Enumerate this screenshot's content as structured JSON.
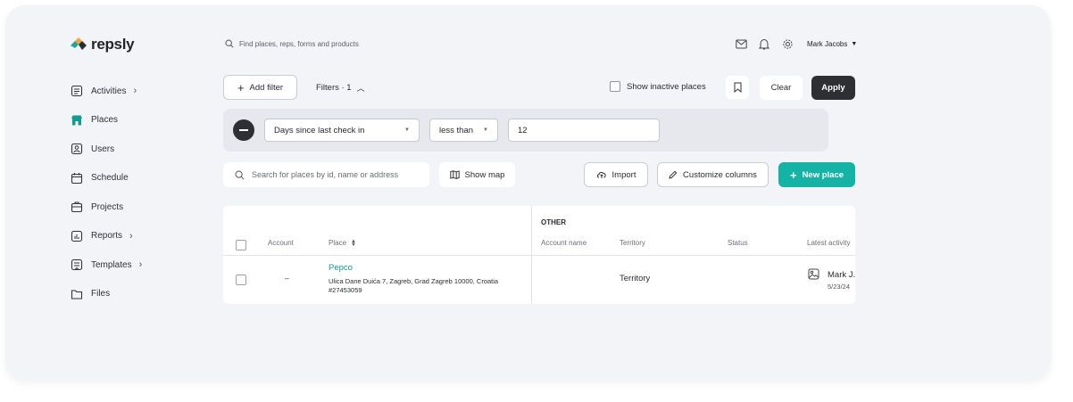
{
  "brand": {
    "name": "repsly"
  },
  "topbar": {
    "search_placeholder": "Find places, reps, forms and products",
    "icons": [
      "mail-icon",
      "bell-icon",
      "gear-icon"
    ],
    "user_name": "Mark Jacobs"
  },
  "sidebar": {
    "items": [
      {
        "label": "Activities",
        "icon": "activities-icon",
        "has_chevron": true
      },
      {
        "label": "Places",
        "icon": "store-icon",
        "has_chevron": false,
        "active": true
      },
      {
        "label": "Users",
        "icon": "user-icon",
        "has_chevron": false
      },
      {
        "label": "Schedule",
        "icon": "calendar-icon",
        "has_chevron": false
      },
      {
        "label": "Projects",
        "icon": "briefcase-icon",
        "has_chevron": false
      },
      {
        "label": "Reports",
        "icon": "chart-icon",
        "has_chevron": true
      },
      {
        "label": "Templates",
        "icon": "template-icon",
        "has_chevron": true
      },
      {
        "label": "Files",
        "icon": "folder-icon",
        "has_chevron": false
      }
    ]
  },
  "toolbar": {
    "add_filter": "Add filter",
    "filters_label": "Filters · 1",
    "show_inactive": "Show inactive places",
    "clear": "Clear",
    "apply": "Apply"
  },
  "filter": {
    "field": "Days since last check in",
    "operator": "less than",
    "value": "12"
  },
  "actions": {
    "search_placeholder": "Search for places by id, name or address",
    "show_map": "Show map",
    "import": "Import",
    "customize_columns": "Customize columns",
    "new_place": "New place"
  },
  "table": {
    "group_header": "OTHER",
    "columns": {
      "account": "Account",
      "place": "Place",
      "account_name": "Account name",
      "territory": "Territory",
      "status": "Status",
      "latest_activity": "Latest activity"
    },
    "rows": [
      {
        "account": "–",
        "place_name": "Pepco",
        "place_address": "Ulica Dane Duića 7, Zagreb, Grad Zagreb 10000, Croatia",
        "place_id": "#27453059",
        "account_name": "",
        "territory": "Territory",
        "status": "",
        "activity_user": "Mark J.",
        "activity_date": "5/23/24"
      }
    ]
  },
  "colors": {
    "accent": "#14b3a6",
    "dark": "#2d2f33",
    "frame": "#f3f4f8"
  }
}
